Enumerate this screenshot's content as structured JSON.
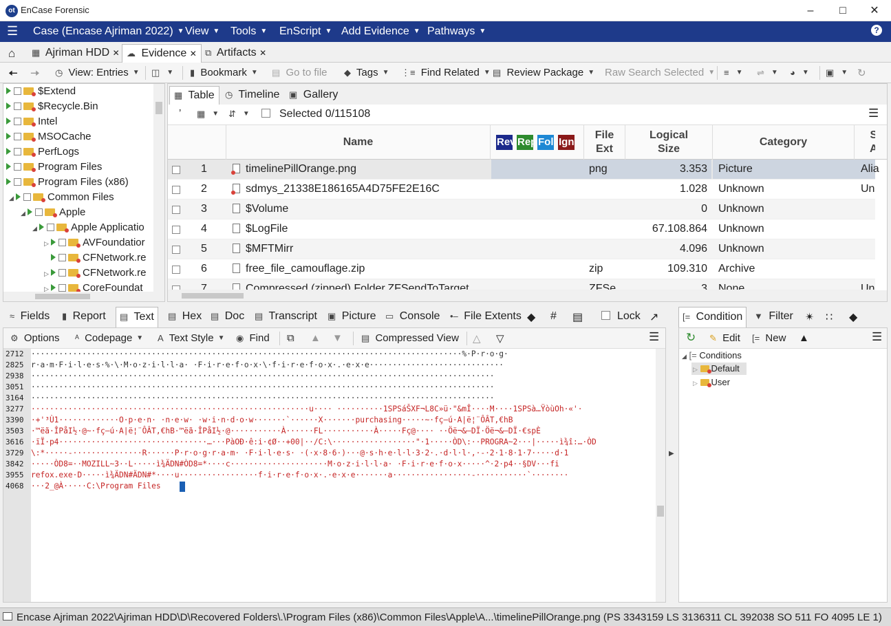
{
  "window": {
    "title": "EnCase Forensic",
    "logo": "ot"
  },
  "menu": [
    {
      "label": "Case (Encase Ajriman 2022)"
    },
    {
      "label": "View"
    },
    {
      "label": "Tools"
    },
    {
      "label": "EnScript"
    },
    {
      "label": "Add Evidence"
    },
    {
      "label": "Pathways"
    }
  ],
  "tabs": [
    {
      "label": "Ajriman HDD"
    },
    {
      "label": "Evidence"
    },
    {
      "label": "Artifacts"
    }
  ],
  "toolbar": {
    "view": "View: Entries",
    "bookmark": "Bookmark",
    "goto": "Go to file",
    "tags": "Tags",
    "find_related": "Find Related",
    "review_package": "Review Package",
    "raw_search": "Raw Search Selected"
  },
  "tree": [
    {
      "label": "$Extend"
    },
    {
      "label": "$Recycle.Bin"
    },
    {
      "label": "Intel"
    },
    {
      "label": "MSOCache"
    },
    {
      "label": "PerfLogs"
    },
    {
      "label": "Program Files"
    },
    {
      "label": "Program Files (x86)"
    },
    {
      "label": "Common Files"
    },
    {
      "label": "Apple"
    },
    {
      "label": "Apple Applicatio"
    },
    {
      "label": "AVFoundatior"
    },
    {
      "label": "CFNetwork.re"
    },
    {
      "label": "CFNetwork.re"
    },
    {
      "label": "CoreFoundat"
    }
  ],
  "view_tabs": {
    "table": "Table",
    "timeline": "Timeline",
    "gallery": "Gallery"
  },
  "selected": "Selected 0/115108",
  "columns": {
    "name": "Name",
    "tags": [
      "Rev",
      "Rep",
      "Fol",
      "Ign"
    ],
    "file_ext": "File Ext",
    "logical_size": "Logical Size",
    "category": "Category",
    "next": "S A"
  },
  "tag_colors": [
    "#1c2a8c",
    "#2e8b2e",
    "#1e88d4",
    "#8b1a1a"
  ],
  "rows": [
    {
      "num": "1",
      "name": "timelinePillOrange.png",
      "ext": "png",
      "size": "3.353",
      "category": "Picture",
      "extra": "Alia"
    },
    {
      "num": "2",
      "name": "sdmys_21338E186165A4D75FE2E16C",
      "ext": "",
      "size": "1.028",
      "category": "Unknown",
      "extra": "Un"
    },
    {
      "num": "3",
      "name": "$Volume",
      "ext": "",
      "size": "0",
      "category": "Unknown",
      "extra": ""
    },
    {
      "num": "4",
      "name": "$LogFile",
      "ext": "",
      "size": "67.108.864",
      "category": "Unknown",
      "extra": ""
    },
    {
      "num": "5",
      "name": "$MFTMirr",
      "ext": "",
      "size": "4.096",
      "category": "Unknown",
      "extra": ""
    },
    {
      "num": "6",
      "name": "free_file_camouflage.zip",
      "ext": "zip",
      "size": "109.310",
      "category": "Archive",
      "extra": ""
    },
    {
      "num": "7",
      "name": "Compressed (zipped) Folder.ZFSendToTarget",
      "ext": "ZFSe...",
      "size": "3",
      "category": "None",
      "extra": "Un"
    }
  ],
  "panel_tabs": [
    "Fields",
    "Report",
    "Text",
    "Hex",
    "Doc",
    "Transcript",
    "Picture",
    "Console",
    "File Extents",
    "Lock"
  ],
  "text_toolbar": {
    "options": "Options",
    "codepage": "Codepage",
    "text_style": "Text Style",
    "find": "Find",
    "compressed_view": "Compressed View"
  },
  "text_lines": [
    {
      "ln": "2712",
      "text": "·····························································································%·P·r·o·g·",
      "style": "blk"
    },
    {
      "ln": "2825",
      "text": "r·a·m·F·i·l·e·s·%·\\·M·o·z·i·l·l·a· ·F·i·r·e·f·o·x·\\·f·i·r·e·f·o·x·.·e·x·e·····························",
      "style": "blk"
    },
    {
      "ln": "2938",
      "text": "····································································································",
      "style": "blk"
    },
    {
      "ln": "3051",
      "text": "····································································································",
      "style": "blk"
    },
    {
      "ln": "3164",
      "text": "····································································································",
      "style": "blk"
    },
    {
      "ln": "3277",
      "text": "····························································u···· ··········1SPSáŠXF¬L8C»ü·\"&mÎ····M····1SPSà…ŸòùOh·«'·",
      "style": "red"
    },
    {
      "ln": "3390",
      "text": "·+'³Ù1·············O·p·e·n· ·n·e·w· ·w·i·n·d·o·w·······`······X·······purchasing·····~·fç—ú·A|ë¦¨ÔÂT,€hB",
      "style": "red"
    },
    {
      "ln": "3503",
      "text": "·™ëã·ÎPåI½·@~·fç—ú·A|ë¦¨ÔÂT,€hB·™ëã·ÎPåI½·@···········À······FL···········À·····Fç@···· ··Öë¬&–DÏ·Öë¬&–DÏ·€spÈ",
      "style": "red"
    },
    {
      "ln": "3616",
      "text": "·ïÏ·p4································…···PàOÐ·ê:i·¢Ø··+00|··/C:\\··················\"·1·····ÒD\\:··PROGRA~2···|·····ì¾î:…·ÒD",
      "style": "red"
    },
    {
      "ln": "3729",
      "text": "\\:*·····-···············R······P·r·o·g·r·a·m· ·F·i·l·e·s· ·(·x·8·6·)···@·s·h·e·l·l·3·2·.·d·l·l·,·-·2·1·8·1·7·····d·1",
      "style": "red"
    },
    {
      "ln": "3842",
      "text": "·····ÒD8=··MOZILL~3··L·····ì¾ÄDN#ÒD8=*····c·····················M·o·z·i·l·l·a· ·F·i·r·e·f·o·x·····^·2·p4··§DV···fi",
      "style": "red"
    },
    {
      "ln": "3955",
      "text": "refox.exe·D·····ì¾ÄDN#ÄDN#*····u·················f·i·r·e·f·o·x·.·e·x·e·······a·················-···········`········",
      "style": "red"
    },
    {
      "ln": "4068",
      "text": "···2_@À·····C:\\Program Files",
      "style": "red"
    }
  ],
  "cond_tabs": {
    "condition": "Condition",
    "filter": "Filter"
  },
  "cond_toolbar": {
    "edit": "Edit",
    "new": "New"
  },
  "conditions": {
    "root": "Conditions",
    "items": [
      "Default",
      "User"
    ]
  },
  "status": "Encase Ajriman 2022\\Ajriman HDD\\D\\Recovered Folders\\.\\Program Files (x86)\\Common Files\\Apple\\A...\\timelinePillOrange.png (PS 3343159 LS 3136311 CL 392038 SO 511 FO 4095 LE 1)"
}
